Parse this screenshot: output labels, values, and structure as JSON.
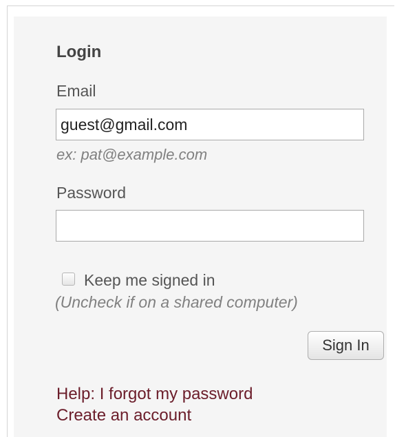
{
  "login": {
    "heading": "Login",
    "email_label": "Email",
    "email_value": "guest@gmail.com",
    "email_hint": "ex: pat@example.com",
    "password_label": "Password",
    "password_value": "",
    "remember_label": "Keep me signed in",
    "remember_note": "(Uncheck if on a shared computer)",
    "remember_checked": false,
    "submit_label": "Sign In"
  },
  "links": {
    "forgot_password": "Help: I forgot my password",
    "create_account": "Create an account"
  },
  "colors": {
    "panel_background": "#f5f5f5",
    "link": "#6b1d2a",
    "label": "#555555",
    "hint": "#808080"
  }
}
